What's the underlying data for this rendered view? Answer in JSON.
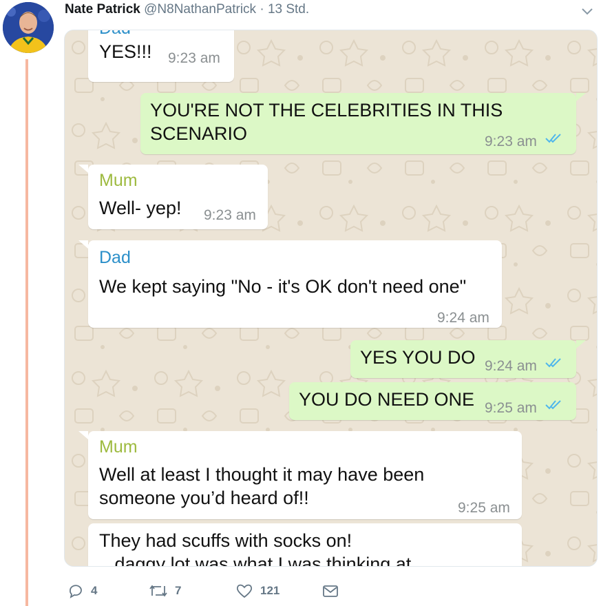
{
  "tweet": {
    "author_name": "Nate Patrick",
    "handle": "@N8NathanPatrick",
    "separator": "·",
    "time": "13 Std."
  },
  "chat": {
    "messages": [
      {
        "sender": "Dad",
        "text": "YES!!!",
        "time": "9:23 am"
      },
      {
        "text_line1": "YOU'RE NOT THE CELEBRITIES IN THIS",
        "text_line2": "SCENARIO",
        "time": "9:23 am"
      },
      {
        "sender": "Mum",
        "text": "Well- yep!",
        "time": "9:23 am"
      },
      {
        "sender": "Dad",
        "text": "We kept saying \"No - it's OK don't need one\"",
        "time": "9:24 am"
      },
      {
        "text": "YES YOU DO",
        "time": "9:24 am"
      },
      {
        "text": "YOU DO NEED ONE",
        "time": "9:25 am"
      },
      {
        "sender": "Mum",
        "text_line1": "Well at least I thought it may have been",
        "text_line2": "someone you’d heard of!!",
        "time": "9:25 am"
      },
      {
        "text_line1": "They had scuffs with socks on!",
        "text_line2": "...daggy lot was what I was thinking at"
      }
    ]
  },
  "actions": {
    "replies": "4",
    "retweets": "7",
    "likes": "121"
  },
  "colors": {
    "outgoing_bubble": "#dcf8c6",
    "incoming_bubble": "#ffffff",
    "wallpaper": "#ece4d6",
    "dad_name": "#2b8fc9",
    "mum_name": "#9dba3f",
    "read_ticks": "#4fb6ec",
    "thread_line": "#f6b8a0"
  }
}
